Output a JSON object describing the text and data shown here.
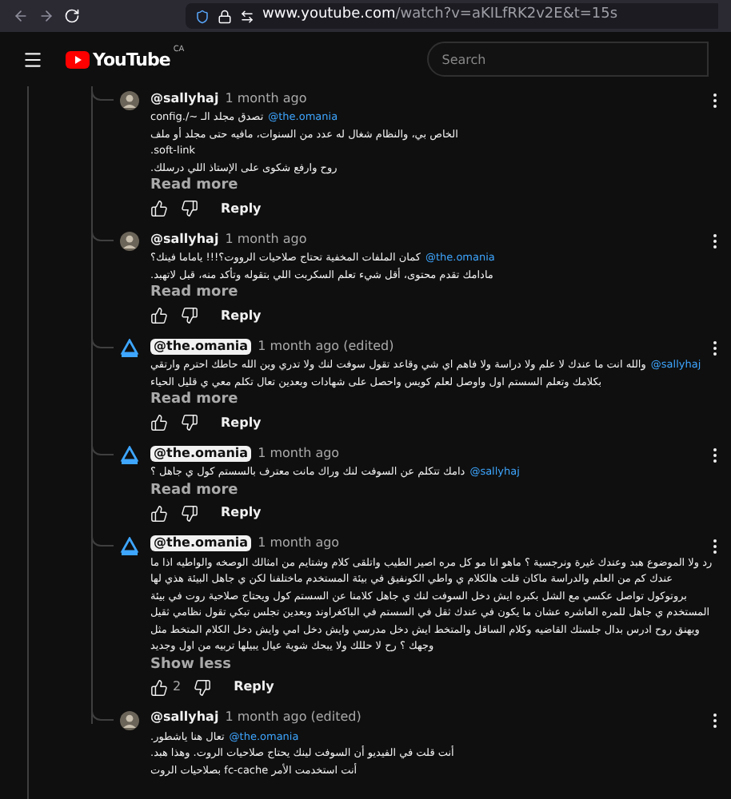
{
  "browser": {
    "url_host": "www.youtube.com",
    "url_path": "/watch?v=aKILfRK2v2E&t=15s"
  },
  "header": {
    "logo": "YouTube",
    "region": "CA",
    "search": {
      "placeholder": "Search"
    }
  },
  "comments": [
    {
      "author": "@sallyhaj",
      "owner": false,
      "time": "1 month ago",
      "lines": [
        {
          "mention": "@the.omania",
          "text": "تصدق مجلد الـ ~/.config"
        },
        {
          "text": "الخاص بي، والنظام شغال له عدد من السنوات، مافيه حتى مجلد أو ملف"
        },
        {
          "text": "soft-link."
        },
        {
          "text": "روح وارفع شكوى على الإستاذ اللي درسلك."
        }
      ],
      "toggle": "Read more",
      "reply": "Reply"
    },
    {
      "author": "@sallyhaj",
      "owner": false,
      "time": "1 month ago",
      "lines": [
        {
          "mention": "@the.omania",
          "text": "كمان الملفات المخفية تحتاج صلاحيات الرووت؟!!! ياماما فينك؟"
        },
        {
          "text": "مادامك تقدم محتوى، أقل شيء تعلم السكربت اللي بتقوله وتأكد منه، قبل لاتهبد."
        }
      ],
      "toggle": "Read more",
      "reply": "Reply"
    },
    {
      "author": "@the.omania",
      "owner": true,
      "time": "1 month ago (edited)",
      "lines": [
        {
          "mention": "@sallyhaj",
          "text": "والله انت ما عندك لا علم ولا دراسة ولا فاهم اي شي وقاعد تقول سوفت لنك ولا تدري وين الله حاطك احترم وارتقي"
        },
        {
          "text": "بكلامك وتعلم السستم اول واوصل لعلم كويس واحصل على شهادات وبعدين تعال تكلم معي ي قليل الحياء"
        }
      ],
      "toggle": "Read more",
      "reply": "Reply"
    },
    {
      "author": "@the.omania",
      "owner": true,
      "time": "1 month ago",
      "lines": [
        {
          "mention": "@sallyhaj",
          "text": "دامك تتكلم عن السوفت لنك وراك مانت معترف بالسستم كول ي جاهل ؟"
        }
      ],
      "toggle": "Read more",
      "reply": "Reply"
    },
    {
      "author": "@the.omania",
      "owner": true,
      "time": "1 month ago",
      "lines": [
        {
          "text": "رد ولا الموضوع هبد وعندك غيرة ونرجسية ؟ ماهو انا مو كل مره اصير الطيب واتلقى كلام وشتايم من امثالك الوصخه والواطيه اذا ما"
        },
        {
          "text": "عندك كم من العلم والدراسة ماكان قلت هالكلام ي واطي الكونفيق في بيئة المستخدم ماختلفنا لكن ي جاهل البيئة هذي لها"
        },
        {
          "text": "بروتوكول تواصل عكسي مع الشل بكبره ايش دخل السوفت لنك ي جاهل كلامنا عن السستم كول ويحتاج صلاحية روت في بيئة"
        },
        {
          "text": "المستخدم ي جاهل للمره العاشره عشان ما يكون في عندك ثقل في السستم في الباكغراوند وبعدين تجلس تبكي تقول نظامي ثقيل"
        },
        {
          "text": "ويهنق روح ادرس بدال جلستك القاضيه وكلام الساقل والمتخط ايش دخل مدرسي وايش دخل امي وايش دخل الكلام المتخط مثل"
        },
        {
          "text": "وجهك ؟ رح لا حللك ولا يبحك شوية عيال يبيلها تربيه من اول وجديد"
        }
      ],
      "toggle": "Show less",
      "likes": "2",
      "reply": "Reply"
    },
    {
      "author": "@sallyhaj",
      "owner": false,
      "time": "1 month ago (edited)",
      "lines": [
        {
          "mention": "@the.omania",
          "text": "تعال هنا ياشطور."
        },
        {
          "text": "أنت قلت في الفيديو أن السوفت لينك يحتاج صلاحيات الروت. وهذا هبد."
        },
        {
          "text": "أنت استخدمت الأمر fc-cache بصلاحيات الروت"
        }
      ]
    }
  ]
}
